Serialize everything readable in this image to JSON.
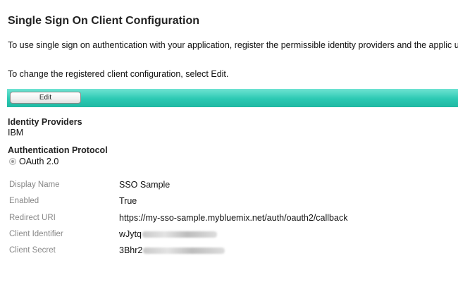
{
  "page": {
    "title": "Single Sign On Client Configuration",
    "intro": "To use single sign on authentication with your application, register the permissible identity providers and the applic users.",
    "change_text": "To change the registered client configuration, select Edit."
  },
  "toolbar": {
    "edit_label": "Edit"
  },
  "identity_providers": {
    "label": "Identity Providers",
    "value": "IBM"
  },
  "authentication_protocol": {
    "label": "Authentication Protocol",
    "option": "OAuth 2.0",
    "selected": true
  },
  "details": [
    {
      "label": "Display Name",
      "value": "SSO Sample"
    },
    {
      "label": "Enabled",
      "value": "True"
    },
    {
      "label": "Redirect URI",
      "value": "https://my-sso-sample.mybluemix.net/auth/oauth2/callback"
    },
    {
      "label": "Client Identifier",
      "value": "wJytq",
      "redacted": true
    },
    {
      "label": "Client Secret",
      "value": "3Bhr2",
      "redacted": true
    }
  ],
  "colors": {
    "toolbar": "#2cc9b3",
    "label_gray": "#888888"
  }
}
